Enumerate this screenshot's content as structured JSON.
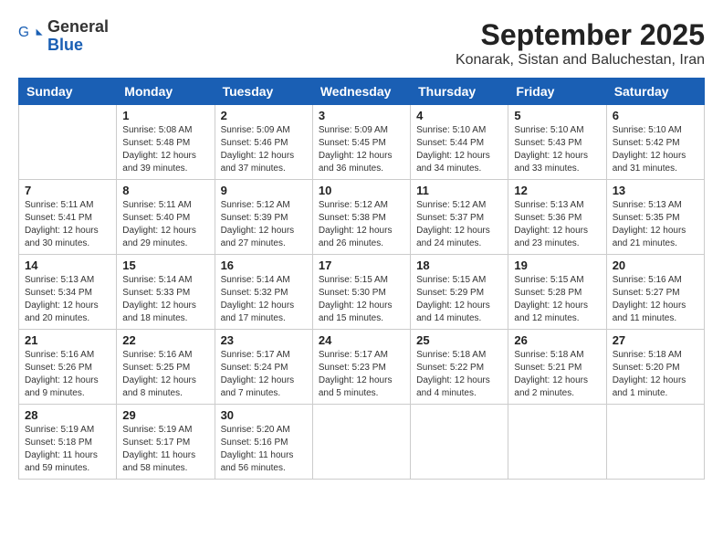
{
  "header": {
    "logo": {
      "general": "General",
      "blue": "Blue"
    },
    "month": "September 2025",
    "location": "Konarak, Sistan and Baluchestan, Iran"
  },
  "weekdays": [
    "Sunday",
    "Monday",
    "Tuesday",
    "Wednesday",
    "Thursday",
    "Friday",
    "Saturday"
  ],
  "weeks": [
    [
      {
        "day": "",
        "info": ""
      },
      {
        "day": "1",
        "info": "Sunrise: 5:08 AM\nSunset: 5:48 PM\nDaylight: 12 hours\nand 39 minutes."
      },
      {
        "day": "2",
        "info": "Sunrise: 5:09 AM\nSunset: 5:46 PM\nDaylight: 12 hours\nand 37 minutes."
      },
      {
        "day": "3",
        "info": "Sunrise: 5:09 AM\nSunset: 5:45 PM\nDaylight: 12 hours\nand 36 minutes."
      },
      {
        "day": "4",
        "info": "Sunrise: 5:10 AM\nSunset: 5:44 PM\nDaylight: 12 hours\nand 34 minutes."
      },
      {
        "day": "5",
        "info": "Sunrise: 5:10 AM\nSunset: 5:43 PM\nDaylight: 12 hours\nand 33 minutes."
      },
      {
        "day": "6",
        "info": "Sunrise: 5:10 AM\nSunset: 5:42 PM\nDaylight: 12 hours\nand 31 minutes."
      }
    ],
    [
      {
        "day": "7",
        "info": "Sunrise: 5:11 AM\nSunset: 5:41 PM\nDaylight: 12 hours\nand 30 minutes."
      },
      {
        "day": "8",
        "info": "Sunrise: 5:11 AM\nSunset: 5:40 PM\nDaylight: 12 hours\nand 29 minutes."
      },
      {
        "day": "9",
        "info": "Sunrise: 5:12 AM\nSunset: 5:39 PM\nDaylight: 12 hours\nand 27 minutes."
      },
      {
        "day": "10",
        "info": "Sunrise: 5:12 AM\nSunset: 5:38 PM\nDaylight: 12 hours\nand 26 minutes."
      },
      {
        "day": "11",
        "info": "Sunrise: 5:12 AM\nSunset: 5:37 PM\nDaylight: 12 hours\nand 24 minutes."
      },
      {
        "day": "12",
        "info": "Sunrise: 5:13 AM\nSunset: 5:36 PM\nDaylight: 12 hours\nand 23 minutes."
      },
      {
        "day": "13",
        "info": "Sunrise: 5:13 AM\nSunset: 5:35 PM\nDaylight: 12 hours\nand 21 minutes."
      }
    ],
    [
      {
        "day": "14",
        "info": "Sunrise: 5:13 AM\nSunset: 5:34 PM\nDaylight: 12 hours\nand 20 minutes."
      },
      {
        "day": "15",
        "info": "Sunrise: 5:14 AM\nSunset: 5:33 PM\nDaylight: 12 hours\nand 18 minutes."
      },
      {
        "day": "16",
        "info": "Sunrise: 5:14 AM\nSunset: 5:32 PM\nDaylight: 12 hours\nand 17 minutes."
      },
      {
        "day": "17",
        "info": "Sunrise: 5:15 AM\nSunset: 5:30 PM\nDaylight: 12 hours\nand 15 minutes."
      },
      {
        "day": "18",
        "info": "Sunrise: 5:15 AM\nSunset: 5:29 PM\nDaylight: 12 hours\nand 14 minutes."
      },
      {
        "day": "19",
        "info": "Sunrise: 5:15 AM\nSunset: 5:28 PM\nDaylight: 12 hours\nand 12 minutes."
      },
      {
        "day": "20",
        "info": "Sunrise: 5:16 AM\nSunset: 5:27 PM\nDaylight: 12 hours\nand 11 minutes."
      }
    ],
    [
      {
        "day": "21",
        "info": "Sunrise: 5:16 AM\nSunset: 5:26 PM\nDaylight: 12 hours\nand 9 minutes."
      },
      {
        "day": "22",
        "info": "Sunrise: 5:16 AM\nSunset: 5:25 PM\nDaylight: 12 hours\nand 8 minutes."
      },
      {
        "day": "23",
        "info": "Sunrise: 5:17 AM\nSunset: 5:24 PM\nDaylight: 12 hours\nand 7 minutes."
      },
      {
        "day": "24",
        "info": "Sunrise: 5:17 AM\nSunset: 5:23 PM\nDaylight: 12 hours\nand 5 minutes."
      },
      {
        "day": "25",
        "info": "Sunrise: 5:18 AM\nSunset: 5:22 PM\nDaylight: 12 hours\nand 4 minutes."
      },
      {
        "day": "26",
        "info": "Sunrise: 5:18 AM\nSunset: 5:21 PM\nDaylight: 12 hours\nand 2 minutes."
      },
      {
        "day": "27",
        "info": "Sunrise: 5:18 AM\nSunset: 5:20 PM\nDaylight: 12 hours\nand 1 minute."
      }
    ],
    [
      {
        "day": "28",
        "info": "Sunrise: 5:19 AM\nSunset: 5:18 PM\nDaylight: 11 hours\nand 59 minutes."
      },
      {
        "day": "29",
        "info": "Sunrise: 5:19 AM\nSunset: 5:17 PM\nDaylight: 11 hours\nand 58 minutes."
      },
      {
        "day": "30",
        "info": "Sunrise: 5:20 AM\nSunset: 5:16 PM\nDaylight: 11 hours\nand 56 minutes."
      },
      {
        "day": "",
        "info": ""
      },
      {
        "day": "",
        "info": ""
      },
      {
        "day": "",
        "info": ""
      },
      {
        "day": "",
        "info": ""
      }
    ]
  ]
}
